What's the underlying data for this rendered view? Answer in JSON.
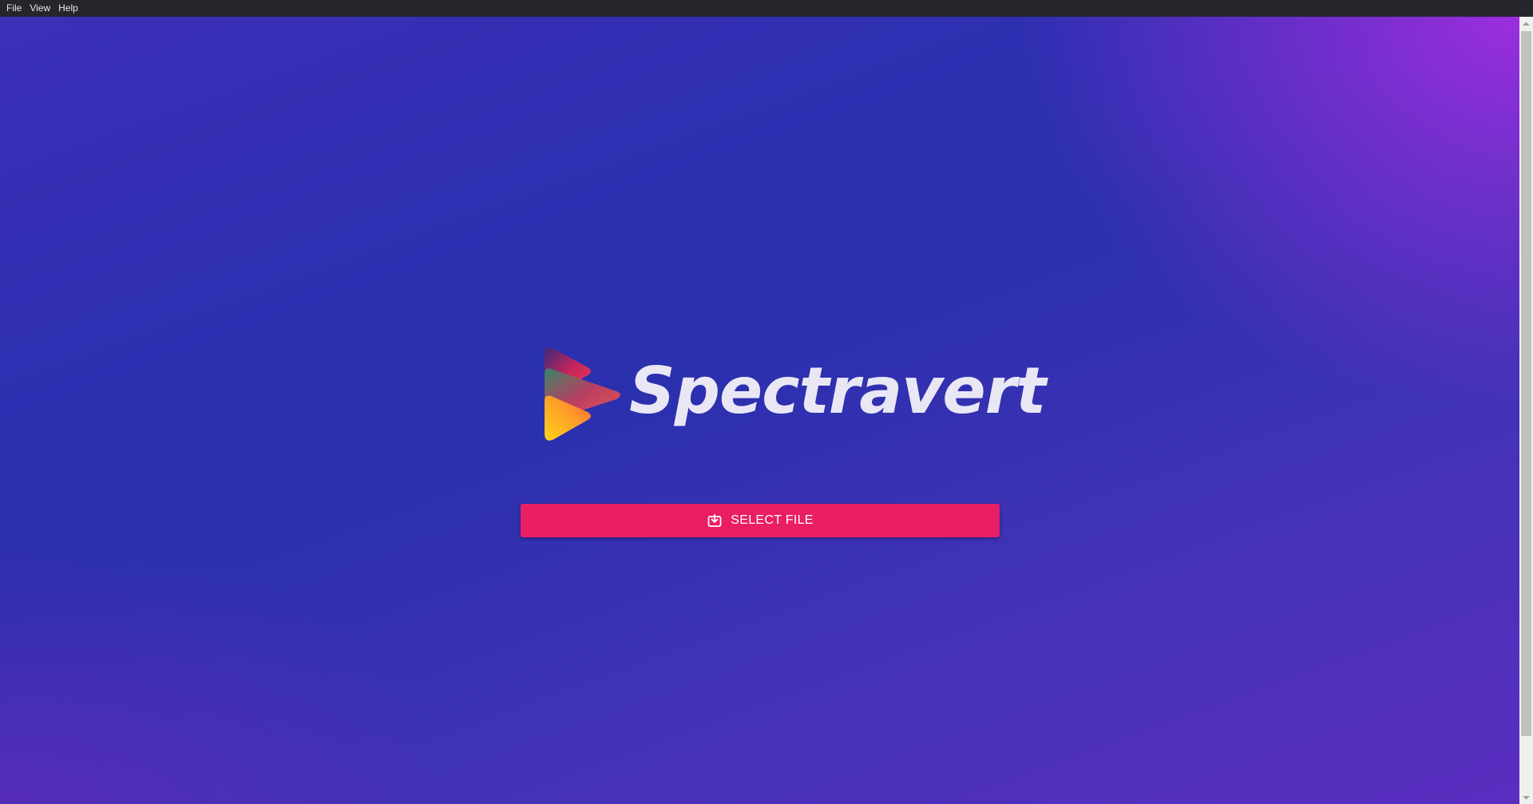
{
  "menubar": {
    "items": [
      {
        "label": "File"
      },
      {
        "label": "View"
      },
      {
        "label": "Help"
      }
    ]
  },
  "app": {
    "name": "Spectravert"
  },
  "actions": {
    "select_file_label": "SELECT FILE",
    "select_file_icon": "download-into-tray-icon"
  },
  "colors": {
    "menubar_bg": "#25262b",
    "button_accent": "#e91e63",
    "background_primary": "#2b2fb0",
    "background_accent": "#b02ee6"
  }
}
